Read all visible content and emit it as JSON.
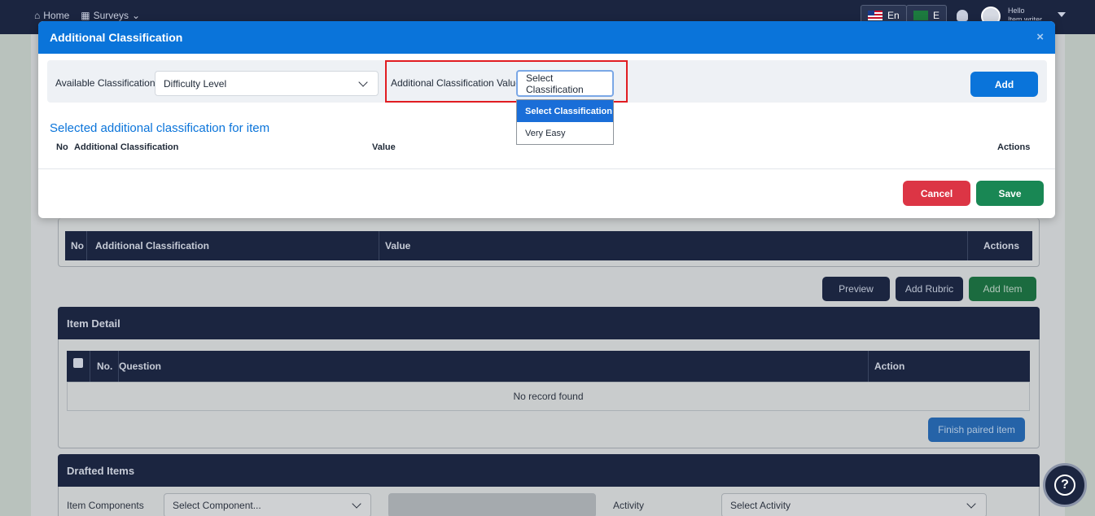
{
  "topbar": {
    "nav": [
      "Home",
      "Surveys"
    ],
    "lang_en": "En",
    "lang_ar": "E",
    "greeting": "Hello",
    "user": "Item writer"
  },
  "modal": {
    "title": "Additional Classification",
    "close": "×",
    "available_label": "Available Classification:",
    "available_value": "Difficulty Level",
    "value_label": "Additional Classification Value",
    "value_selected": "Select Classification",
    "add": "Add",
    "section_title": "Selected additional classification for item",
    "columns": {
      "no": "No",
      "classification": "Additional Classification",
      "value": "Value",
      "actions": "Actions"
    },
    "cancel": "Cancel",
    "save": "Save",
    "dropdown_options": [
      "Select Classification",
      "Very Easy"
    ]
  },
  "background": {
    "table_columns": {
      "no": "No",
      "classification": "Additional Classification",
      "value": "Value",
      "actions": "Actions"
    },
    "preview": "Preview",
    "add_rubric": "Add Rubric",
    "add_item": "Add Item",
    "item_detail": {
      "title": "Item Detail",
      "columns": {
        "no": "No.",
        "question": "Question",
        "action": "Action"
      },
      "empty": "No record found",
      "finish": "Finish paired item"
    },
    "drafted": {
      "title": "Drafted Items",
      "components_label": "Item Components",
      "components_placeholder": "Select Component...",
      "activity_label": "Activity",
      "activity_placeholder": "Select Activity"
    }
  },
  "colors": {
    "primary": "#0a74da",
    "danger": "#dc3545",
    "success": "#198754",
    "navy": "#1b2540",
    "highlight": "#e11d22"
  }
}
